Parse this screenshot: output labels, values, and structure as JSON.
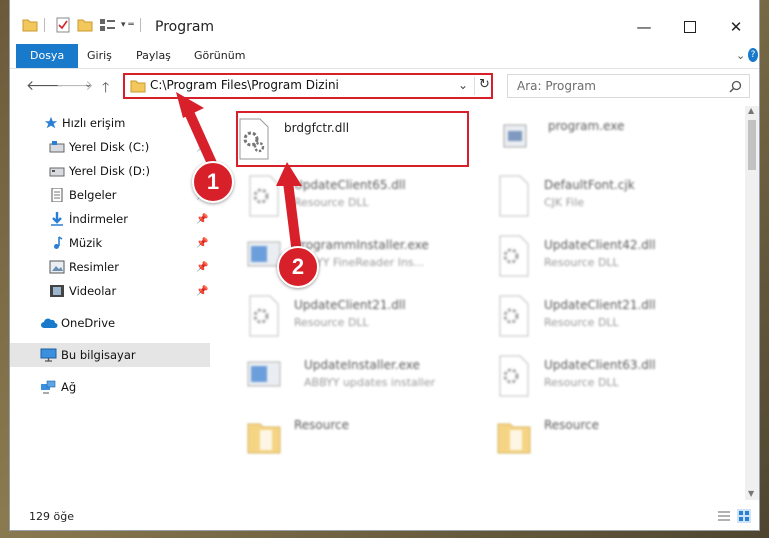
{
  "window": {
    "title": "Program"
  },
  "ribbon": {
    "tabs": [
      {
        "label": "Dosya",
        "active": true
      },
      {
        "label": "Giriş"
      },
      {
        "label": "Paylaş"
      },
      {
        "label": "Görünüm"
      }
    ]
  },
  "address": {
    "path": "C:\\Program Files\\Program Dizini"
  },
  "search": {
    "placeholder": "Ara: Program"
  },
  "sidebar": {
    "items": [
      {
        "label": "Hızlı erişim",
        "icon": "star-icon"
      },
      {
        "label": "Yerel Disk (C:)",
        "icon": "drive-icon",
        "pinned": true
      },
      {
        "label": "Yerel Disk (D:)",
        "icon": "drive-icon",
        "pinned": true
      },
      {
        "label": "Belgeler",
        "icon": "documents-icon",
        "pinned": true
      },
      {
        "label": "İndirmeler",
        "icon": "download-icon",
        "pinned": true
      },
      {
        "label": "Müzik",
        "icon": "music-icon",
        "pinned": true
      },
      {
        "label": "Resimler",
        "icon": "pictures-icon",
        "pinned": true
      },
      {
        "label": "Videolar",
        "icon": "videos-icon",
        "pinned": true
      },
      {
        "label": "OneDrive",
        "icon": "cloud-icon"
      },
      {
        "label": "Bu bilgisayar",
        "icon": "computer-icon",
        "selected": true
      },
      {
        "label": "Ağ",
        "icon": "network-icon"
      }
    ]
  },
  "files": [
    {
      "name": "brdgfctr.dll",
      "type": "",
      "icon": "dll-gear-icon"
    },
    {
      "name": "program.exe",
      "type": "",
      "icon": "exe-icon"
    },
    {
      "name": "UpdateClient65.dll",
      "type": "Resource DLL",
      "icon": "dll-gear-icon"
    },
    {
      "name": "DefaultFont.cjk",
      "type": "CJK File",
      "icon": "blank-file-icon"
    },
    {
      "name": "ProgrammInstaller.exe",
      "type": "ABBYY FineReader Ins...",
      "icon": "installer-icon"
    },
    {
      "name": "UpdateClient42.dll",
      "type": "Resource DLL",
      "icon": "dll-gear-icon"
    },
    {
      "name": "UpdateClient21.dll",
      "type": "Resource DLL",
      "icon": "dll-gear-icon"
    },
    {
      "name": "UpdateClient21.dll",
      "type": "Resource DLL",
      "icon": "dll-gear-icon"
    },
    {
      "name": "UpdateInstaller.exe",
      "type": "ABBYY updates installer",
      "icon": "installer-icon"
    },
    {
      "name": "UpdateClient63.dll",
      "type": "Resource DLL",
      "icon": "dll-gear-icon"
    },
    {
      "name": "Resource",
      "type": "",
      "icon": "folder-icon"
    },
    {
      "name": "Resource",
      "type": "",
      "icon": "folder-icon"
    }
  ],
  "status": {
    "count": "129 öğe"
  },
  "callouts": {
    "one": "1",
    "two": "2"
  },
  "colors": {
    "accent": "#1979ca",
    "highlight": "#d8202a"
  }
}
